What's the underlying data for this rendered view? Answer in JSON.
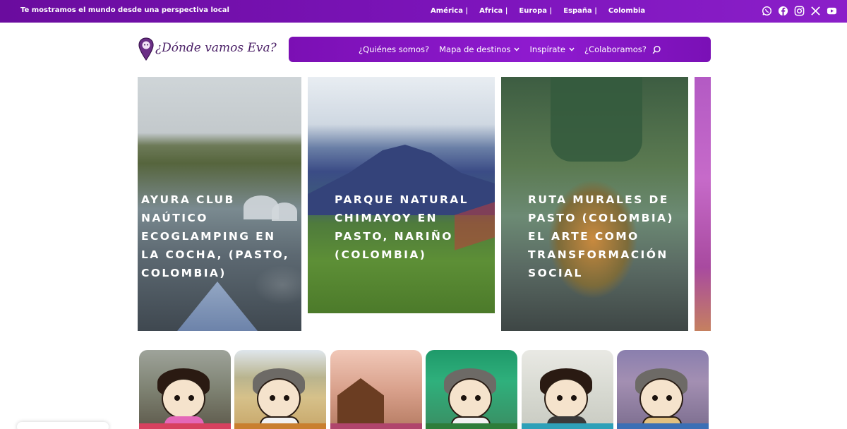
{
  "topbar": {
    "tagline": "Te mostramos el mundo desde una perspectiva local",
    "links": [
      "América |",
      "Africa |",
      "Europa |",
      "España |",
      "Colombia"
    ],
    "social_icons": [
      "whatsapp-icon",
      "facebook-icon",
      "instagram-icon",
      "x-icon",
      "youtube-icon"
    ]
  },
  "header": {
    "logo_text": "¿Dónde vamos Eva?",
    "nav": {
      "quienes": "¿Quiénes somos?",
      "mapa": "Mapa de destinos",
      "inspirate": "Inspírate",
      "colaboramos": "¿Colaboramos?"
    }
  },
  "carousel": [
    {
      "title": "AYURA CLUB NAÚTICO ECOGLAMPING EN LA COCHA, (PASTO, COLOMBIA)"
    },
    {
      "title": "PARQUE NATURAL CHIMAYOY EN PASTO, NARIÑO (COLOMBIA)"
    },
    {
      "title": "RUTA MURALES DE PASTO (COLOMBIA) EL ARTE COMO TRANSFORMACIÓN SOCIAL"
    }
  ],
  "colors": {
    "brand_purple": "#7b0fb4",
    "topbar_purple": "#6a0c9e"
  }
}
